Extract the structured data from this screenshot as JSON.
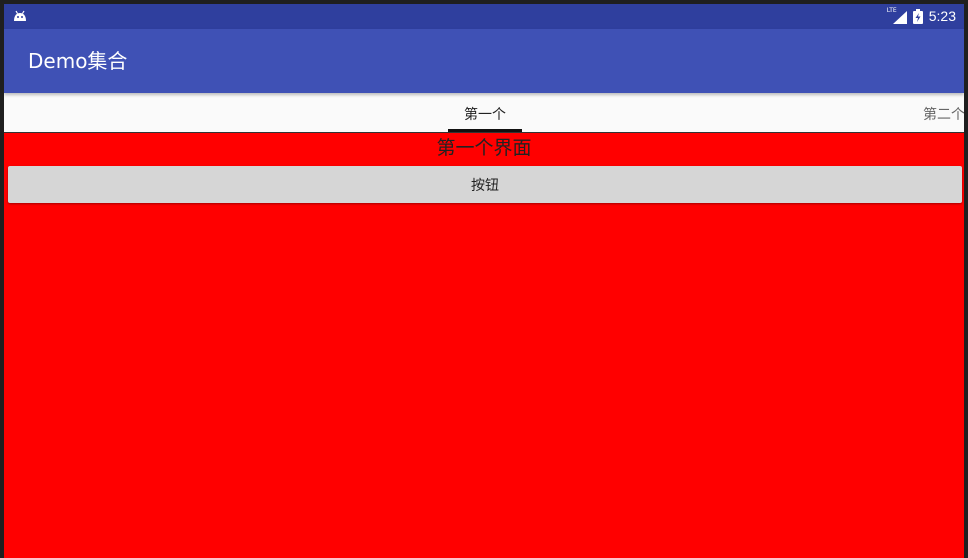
{
  "status_bar": {
    "notification_icon": "android-icon",
    "network_label": "LTE",
    "signal_icon": "signal-icon",
    "battery_icon": "battery-charging-icon",
    "time": "5:23"
  },
  "app_bar": {
    "title": "Demo集合"
  },
  "tabs": [
    {
      "label": "第一个",
      "selected": true
    },
    {
      "label": "第二个",
      "selected": false
    }
  ],
  "page": {
    "heading": "第一个界面",
    "button_label": "按钮"
  },
  "colors": {
    "status_bar": "#2f3f9e",
    "app_bar": "#3f51b5",
    "page_background": "#ff0000",
    "button": "#d6d6d6"
  }
}
